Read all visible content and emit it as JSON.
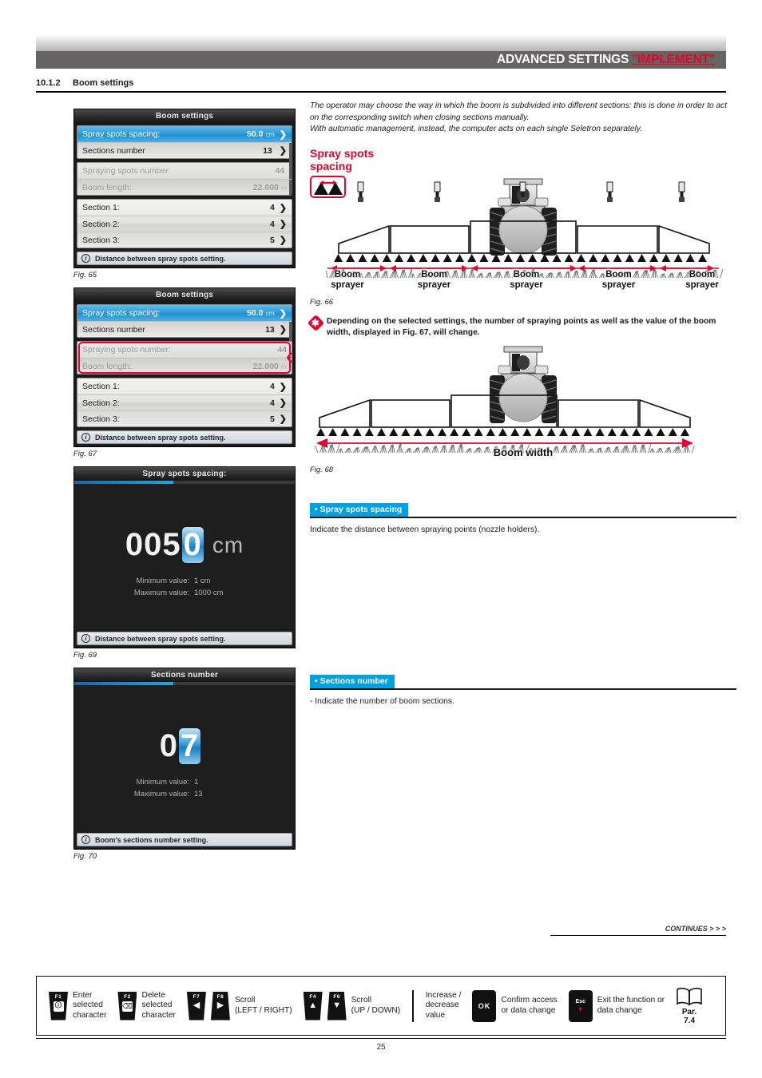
{
  "header": {
    "title_main": "ADVANCED SETTINGS",
    "title_highlight": "\"IMPLEMENT\""
  },
  "section": {
    "number": "10.1.2",
    "title": "Boom settings"
  },
  "intro": {
    "line1": "The operator may choose the way in which the boom is subdivided into different sections: this is done in order to act on the corresponding switch when closing sections manually.",
    "line2": "With automatic management, instead, the computer acts on each single Seletron separately."
  },
  "spray_spots_heading": {
    "line1": "Spray spots",
    "line2": "spacing"
  },
  "screens": {
    "fig65": {
      "title": "Boom settings",
      "caption": "Fig. 65",
      "rows_group1": [
        {
          "label": "Spray spots spacing:",
          "value": "50.0",
          "unit": "cm",
          "chevron": "❯",
          "state": "selected"
        },
        {
          "label": "Sections number",
          "value": "13",
          "unit": "",
          "chevron": "❯",
          "state": "normal"
        }
      ],
      "rows_group2": [
        {
          "label": "Spraying spots number:",
          "value": "44",
          "unit": "",
          "chevron": "",
          "state": "disabled"
        },
        {
          "label": "Boom length:",
          "value": "22.000",
          "unit": "m",
          "chevron": "",
          "state": "disabled"
        }
      ],
      "rows_group3": [
        {
          "label": "Section 1:",
          "value": "4",
          "unit": "",
          "chevron": "❯",
          "state": "normal"
        },
        {
          "label": "Section 2:",
          "value": "4",
          "unit": "",
          "chevron": "❯",
          "state": "normal"
        },
        {
          "label": "Section 3:",
          "value": "5",
          "unit": "",
          "chevron": "❯",
          "state": "normal"
        }
      ],
      "info": "Distance between spray spots setting."
    },
    "fig67": {
      "title": "Boom settings",
      "caption": "Fig. 67",
      "rows_group1": [
        {
          "label": "Spray spots spacing:",
          "value": "50.0",
          "unit": "cm",
          "chevron": "❯",
          "state": "selected"
        },
        {
          "label": "Sections number",
          "value": "13",
          "unit": "",
          "chevron": "❯",
          "state": "normal"
        }
      ],
      "rows_group2": [
        {
          "label": "Spraying spots number:",
          "value": "44",
          "unit": "",
          "chevron": "",
          "state": "disabled"
        },
        {
          "label": "Boom length:",
          "value": "22.000",
          "unit": "m",
          "chevron": "",
          "state": "disabled"
        }
      ],
      "rows_group3": [
        {
          "label": "Section 1:",
          "value": "4",
          "unit": "",
          "chevron": "❯",
          "state": "normal"
        },
        {
          "label": "Section 2:",
          "value": "4",
          "unit": "",
          "chevron": "❯",
          "state": "normal"
        },
        {
          "label": "Section 3:",
          "value": "5",
          "unit": "",
          "chevron": "❯",
          "state": "normal"
        }
      ],
      "info": "Distance between spray spots setting.",
      "highlight_marker": "✱"
    },
    "fig69": {
      "title": "Spray spots spacing:",
      "caption": "Fig. 69",
      "value_prefix": "005",
      "value_cursor": "0",
      "value_unit": "cm",
      "min_label": "Minimum value:",
      "min_value": "1 cm",
      "max_label": "Maximum value:",
      "max_value": "1000 cm",
      "info": "Distance between spray spots setting."
    },
    "fig70": {
      "title": "Sections number",
      "caption": "Fig. 70",
      "value_prefix": "0",
      "value_cursor": "7",
      "value_unit": "",
      "min_label": "Minimum value:",
      "min_value": "1",
      "max_label": "Maximum value:",
      "max_value": "13",
      "info": "Boom's sections number setting."
    }
  },
  "figures": {
    "fig66": {
      "caption": "Fig. 66",
      "boom_labels": [
        "Boom\nsprayer",
        "Boom\nsprayer",
        "Boom\nsprayer",
        "Boom\nsprayer",
        "Boom\nsprayer"
      ],
      "label_l1": "Boom",
      "label_l2": "sprayer"
    },
    "fig68": {
      "caption": "Fig. 68",
      "width_label": "Boom width"
    }
  },
  "note": {
    "marker": "✱",
    "text": "Depending on the selected settings, the number of spraying points as well as the value of the boom width, displayed in Fig. 67, will change."
  },
  "blocks": [
    {
      "tag": "• Spray spots spacing",
      "body": "Indicate the distance between spraying points (nozzle holders)."
    },
    {
      "tag": "• Sections number",
      "body": "- Indicate the number of boom sections."
    }
  ],
  "footer": {
    "continues": "CONTINUES > > >",
    "page_number": "25",
    "keys": [
      {
        "key": "F1",
        "glyph": "ℹ",
        "text1": "Enter",
        "text2": "selected",
        "text3": "character"
      },
      {
        "key": "F2",
        "glyph": "⌫",
        "text1": "Delete",
        "text2": "selected",
        "text3": "character"
      },
      {
        "key": "F7",
        "glyph": "◀",
        "key2": "F8",
        "glyph2": "▶",
        "text1": "Scroll",
        "text2": "(LEFT / RIGHT)"
      },
      {
        "key": "F4",
        "glyph": "▲",
        "key2": "F6",
        "glyph2": "▼",
        "text1": "Scroll",
        "text2": "(UP / DOWN)"
      }
    ],
    "increase_decrease": {
      "l1": "Increase /",
      "l2": "decrease",
      "l3": "value"
    },
    "ok": {
      "label": "OK",
      "text1": "Confirm access",
      "text2": "or data change"
    },
    "esc": {
      "label": "Esc",
      "dot": "♦",
      "text1": "Exit the function or",
      "text2": "data change"
    },
    "book": {
      "l1": "Par.",
      "l2": "7.4"
    }
  },
  "colors": {
    "accent_red": "#e4032e",
    "accent_blue": "#00a0e1",
    "header_band": "#666463",
    "selected_row": "#2f9ddc"
  }
}
